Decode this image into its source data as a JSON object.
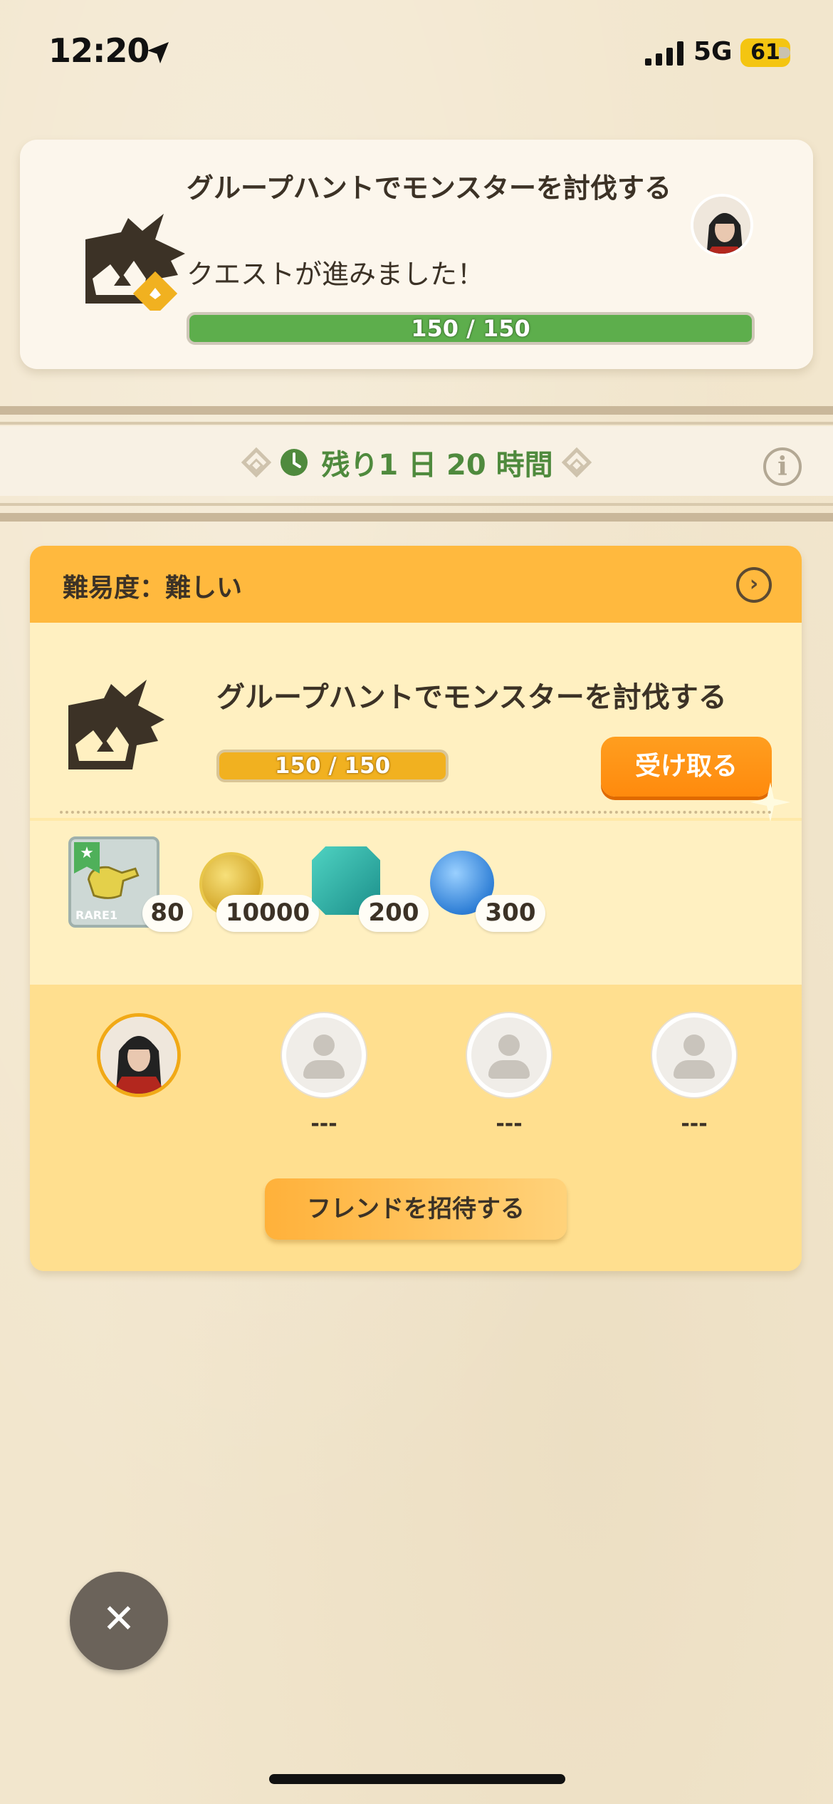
{
  "status_bar": {
    "time": "12:20",
    "network": "5G",
    "battery": "61"
  },
  "notification": {
    "title": "グループハントでモンスターを討伐する",
    "subtitle": "クエストが進みました！",
    "progress_text": "150 / 150",
    "progress": 1.0,
    "icon": "monster-quest-icon",
    "badge_icon": "hand-badge-icon"
  },
  "timer": {
    "text": "残り1 日 20 時間"
  },
  "quest_card": {
    "difficulty_label": "難易度：難しい",
    "title": "グループハントでモンスターを討伐する",
    "progress_text": "150 / 150",
    "progress": 1.0,
    "claim_label": "受け取る",
    "rewards": [
      {
        "icon": "part-rare1-icon",
        "rarity": "RARE1",
        "qty": "80"
      },
      {
        "icon": "zenny-coin-icon",
        "qty": "10000"
      },
      {
        "icon": "armor-sphere-icon",
        "qty": "200"
      },
      {
        "icon": "blue-orb-icon",
        "qty": "300"
      }
    ],
    "members": [
      {
        "name": "",
        "empty": false
      },
      {
        "name": "---",
        "empty": true
      },
      {
        "name": "---",
        "empty": true
      },
      {
        "name": "---",
        "empty": true
      }
    ],
    "invite_label": "フレンドを招待する"
  },
  "colors": {
    "accent_orange": "#ff8a0d",
    "progress_green": "#5dae4c",
    "progress_yellow": "#f1b120",
    "timer_green": "#4f8a3d"
  }
}
